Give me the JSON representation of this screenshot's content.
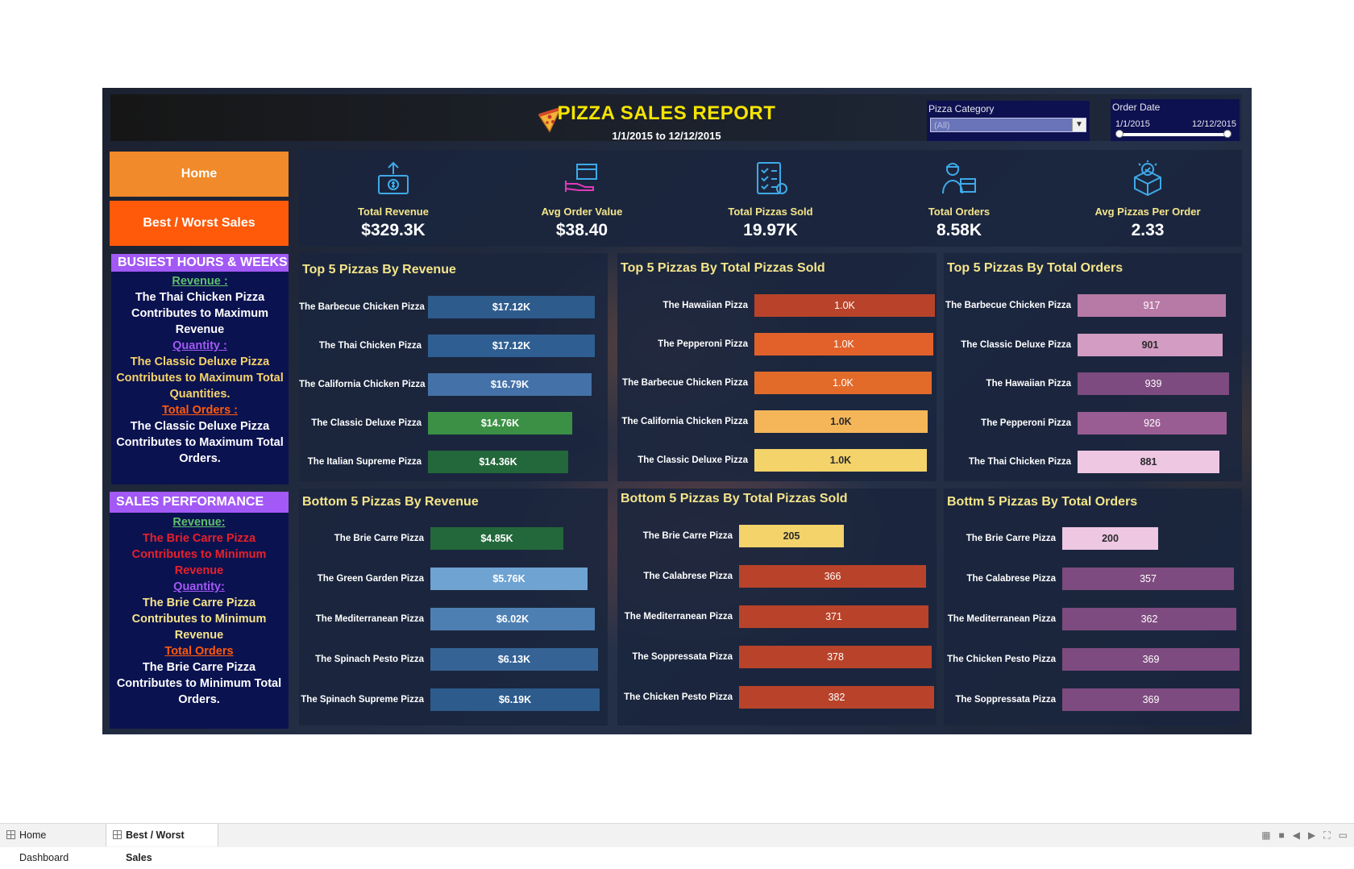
{
  "header": {
    "title": "PIZZA SALES REPORT",
    "date_range": "1/1/2015 to 12/12/2015"
  },
  "filters": {
    "category": {
      "label": "Pizza Category",
      "value": "(All)"
    },
    "order_date": {
      "label": "Order Date",
      "start": "1/1/2015",
      "end": "12/12/2015"
    }
  },
  "nav": {
    "home": "Home",
    "best_worst": "Best / Worst Sales"
  },
  "kpis": [
    {
      "label": "Total Revenue",
      "value": "$329.3K",
      "icon": "money-hand-icon"
    },
    {
      "label": "Avg Order Value",
      "value": "$38.40",
      "icon": "order-box-hand-icon"
    },
    {
      "label": "Total Pizzas Sold",
      "value": "19.97K",
      "icon": "checklist-icon"
    },
    {
      "label": "Total Orders",
      "value": "8.58K",
      "icon": "delivery-person-icon"
    },
    {
      "label": "Avg Pizzas Per Order",
      "value": "2.33",
      "icon": "box-check-icon"
    }
  ],
  "busiest": {
    "title": "BUSIEST HOURS & WEEKS",
    "revenue_label": "Revenue :",
    "revenue_text": "The Thai Chicken Pizza Contributes to Maximum Revenue",
    "quantity_label": "Quantity :",
    "quantity_text": "The Classic Deluxe Pizza Contributes to Maximum Total Quantities.",
    "orders_label": "Total Orders :",
    "orders_text": "The Classic Deluxe Pizza Contributes to Maximum Total Orders."
  },
  "performance": {
    "title": "SALES PERFORMANCE",
    "revenue_label": "Revenue:",
    "revenue_text": "The Brie Carre Pizza Contributes to Minimum Revenue",
    "quantity_label": "Quantity:",
    "quantity_text": "The Brie Carre Pizza Contributes to Minimum Revenue",
    "orders_label": "Total Orders",
    "orders_text": "The Brie Carre Pizza Contributes to Minimum Total Orders."
  },
  "colors": {
    "title_yellow": "#f5e400",
    "home_button": "#f08a2a",
    "best_worst_button": "#ff5a0a",
    "side_header": "#a259f5",
    "side_body": "#0b1250"
  },
  "chart_data": [
    {
      "type": "bar",
      "id": "top-revenue",
      "title": "Top 5 Pizzas By Revenue",
      "categories": [
        "The Barbecue Chicken Pizza",
        "The Thai Chicken Pizza",
        "The California Chicken Pizza",
        "The Classic Deluxe Pizza",
        "The Italian Supreme Pizza"
      ],
      "values": [
        17.12,
        17.12,
        16.79,
        14.76,
        14.36
      ],
      "labels": [
        "$17.12K",
        "$17.12K",
        "$16.79K",
        "$14.76K",
        "$14.36K"
      ],
      "colors": [
        "#2d5b8c",
        "#2f5f92",
        "#4472a8",
        "#3b9045",
        "#23683a"
      ],
      "xlim": [
        0,
        17.5
      ]
    },
    {
      "type": "bar",
      "id": "top-sold",
      "title": "Top 5 Pizzas By Total Pizzas Sold",
      "categories": [
        "The Hawaiian Pizza",
        "The Pepperoni Pizza",
        "The Barbecue Chicken Pizza",
        "The California Chicken Pizza",
        "The Classic Deluxe Pizza"
      ],
      "values": [
        1.02,
        1.01,
        1.0,
        0.98,
        0.975
      ],
      "labels": [
        "1.0K",
        "1.0K",
        "1.0K",
        "1.0K",
        "1.0K"
      ],
      "colors": [
        "#b8432a",
        "#e2612a",
        "#e26b2a",
        "#f5b65a",
        "#f3d36a"
      ],
      "xlim": [
        0,
        1.02
      ]
    },
    {
      "type": "bar",
      "id": "top-orders",
      "title": "Top 5 Pizzas By Total Orders",
      "categories": [
        "The Barbecue Chicken Pizza",
        "The Classic Deluxe Pizza",
        "The Hawaiian Pizza",
        "The Pepperoni Pizza",
        "The Thai Chicken Pizza"
      ],
      "values": [
        917,
        901,
        939,
        926,
        881
      ],
      "labels": [
        "917",
        "901",
        "939",
        "926",
        "881"
      ],
      "colors": [
        "#b77aa6",
        "#d39cc3",
        "#7d4b7f",
        "#9a5d93",
        "#eec7e3"
      ],
      "xlim": [
        0,
        939
      ]
    },
    {
      "type": "bar",
      "id": "bottom-revenue",
      "title": "Bottom 5 Pizzas By Revenue",
      "categories": [
        "The Brie Carre Pizza",
        "The Green Garden Pizza",
        "The Mediterranean Pizza",
        "The Spinach Pesto Pizza",
        "The Spinach Supreme Pizza"
      ],
      "values": [
        4.85,
        5.76,
        6.02,
        6.13,
        6.19
      ],
      "labels": [
        "$4.85K",
        "$5.76K",
        "$6.02K",
        "$6.13K",
        "$6.19K"
      ],
      "colors": [
        "#23683a",
        "#6ea3d2",
        "#4e7fb3",
        "#356396",
        "#2d5b8c"
      ],
      "xlim": [
        0,
        6.19
      ]
    },
    {
      "type": "bar",
      "id": "bottom-sold",
      "title": "Bottom 5 Pizzas By Total Pizzas Sold",
      "categories": [
        "The Brie Carre Pizza",
        "The Calabrese Pizza",
        "The Mediterranean Pizza",
        "The Soppressata Pizza",
        "The Chicken Pesto Pizza"
      ],
      "values": [
        205,
        366,
        371,
        378,
        382
      ],
      "labels": [
        "205",
        "366",
        "371",
        "378",
        "382"
      ],
      "colors": [
        "#f3d36a",
        "#b8432a",
        "#b8432a",
        "#b8432a",
        "#b8432a"
      ],
      "xlim": [
        0,
        382
      ]
    },
    {
      "type": "bar",
      "id": "bottom-orders",
      "title": "Bottm 5 Pizzas By Total Orders",
      "categories": [
        "The Brie Carre Pizza",
        "The Calabrese Pizza",
        "The Mediterranean Pizza",
        "The Chicken Pesto Pizza",
        "The Soppressata Pizza"
      ],
      "values": [
        200,
        357,
        362,
        369,
        369
      ],
      "labels": [
        "200",
        "357",
        "362",
        "369",
        "369"
      ],
      "colors": [
        "#eec7e3",
        "#7d4b7f",
        "#7d4b7f",
        "#7d4b7f",
        "#7d4b7f"
      ],
      "xlim": [
        0,
        369
      ]
    }
  ],
  "taskbar": {
    "tabs": [
      "Home Dashboard",
      "Best / Worst Sales"
    ]
  }
}
